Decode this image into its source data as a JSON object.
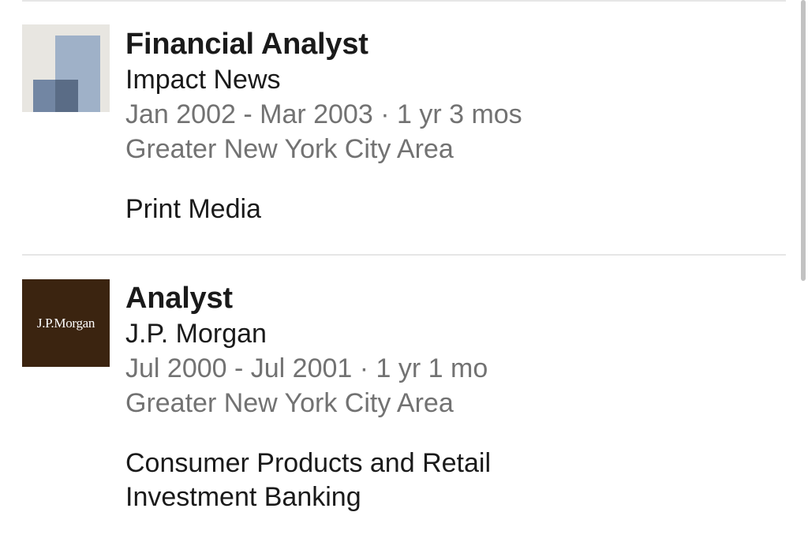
{
  "experience": [
    {
      "title": "Financial Analyst",
      "company": "Impact News",
      "dates": "Jan 2002 - Mar 2003 · 1 yr 3 mos",
      "location": "Greater New York City Area",
      "description": "Print Media",
      "logo_icon": "company-placeholder-icon"
    },
    {
      "title": "Analyst",
      "company": "J.P. Morgan",
      "dates": "Jul 2000 - Jul 2001 · 1 yr 1 mo",
      "location": "Greater New York City Area",
      "description": "Consumer Products and Retail Investment Banking",
      "logo_text": "J.P.Morgan",
      "logo_icon": "jpmorgan-logo",
      "logo_color": "#3b2410"
    }
  ]
}
